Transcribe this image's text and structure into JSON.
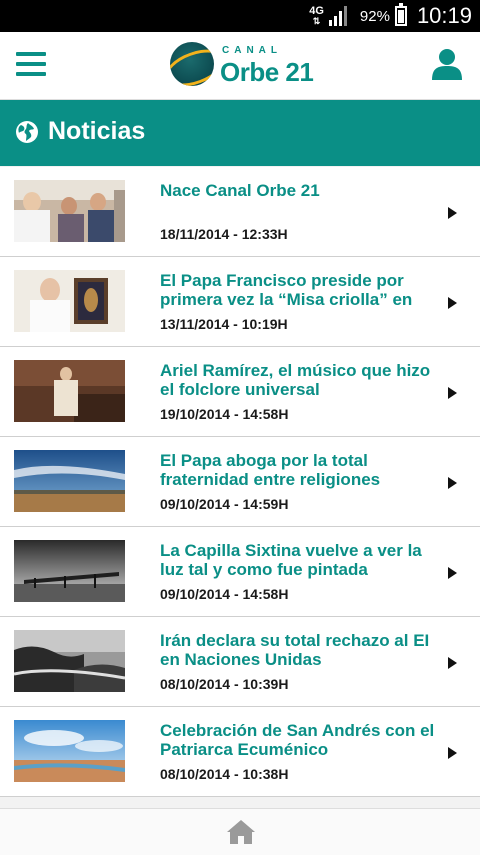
{
  "status_bar": {
    "network": "4G",
    "battery": "92%",
    "battery_level": 0.92,
    "time": "10:19"
  },
  "header": {
    "logo_small": "CANAL",
    "logo_main": "Orbe 21"
  },
  "section": {
    "title": "Noticias"
  },
  "colors": {
    "accent": "#0a8f86",
    "logo_gold": "#f2b21b"
  },
  "news": [
    {
      "title": "Nace Canal Orbe 21",
      "date": "18/11/2014 - 12:33H"
    },
    {
      "title": "El Papa Francisco preside por primera vez la “Misa criolla” en",
      "date": "13/11/2014 - 10:19H"
    },
    {
      "title": "Ariel Ramírez, el músico que hizo el folclore universal",
      "date": "19/10/2014 - 14:58H"
    },
    {
      "title": "El Papa aboga por la total fraternidad entre religiones",
      "date": "09/10/2014 - 14:59H"
    },
    {
      "title": "La Capilla Sixtina vuelve a ver la luz tal y como fue pintada",
      "date": "09/10/2014 - 14:58H"
    },
    {
      "title": "Irán declara su total rechazo al EI en Naciones Unidas",
      "date": "08/10/2014 - 10:39H"
    },
    {
      "title": "Celebración de San Andrés con el Patriarca Ecuménico",
      "date": "08/10/2014 - 10:38H"
    }
  ]
}
